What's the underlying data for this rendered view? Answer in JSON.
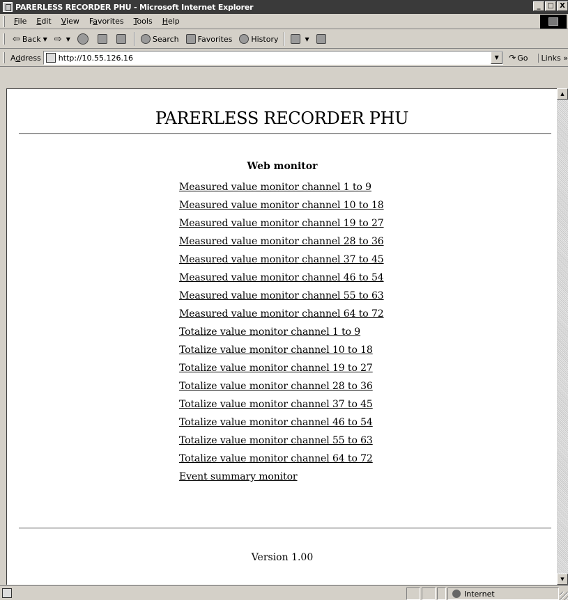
{
  "window": {
    "title": "PARERLESS RECORDER PHU - Microsoft Internet Explorer",
    "min": "_",
    "max": "□",
    "close": "X"
  },
  "menu": {
    "items": [
      {
        "key": "F",
        "rest": "ile"
      },
      {
        "key": "E",
        "rest": "dit"
      },
      {
        "key": "V",
        "rest": "iew"
      },
      {
        "pre": "F",
        "key": "a",
        "rest": "vorites"
      },
      {
        "key": "T",
        "rest": "ools"
      },
      {
        "key": "H",
        "rest": "elp"
      }
    ]
  },
  "toolbar": {
    "back": "Back",
    "search": "Search",
    "favorites": "Favorites",
    "history": "History"
  },
  "address": {
    "label_pre": "A",
    "label_key": "d",
    "label_rest": "dress",
    "url": "http://10.55.126.16",
    "go": "Go",
    "links": "Links »"
  },
  "page": {
    "title": "PARERLESS RECORDER PHU",
    "section": "Web monitor",
    "links": [
      "Measured value monitor channel 1 to 9",
      "Measured value monitor channel 10 to 18",
      "Measured value monitor channel 19 to 27",
      "Measured value monitor channel 28 to 36",
      "Measured value monitor channel 37 to 45",
      "Measured value monitor channel 46 to 54",
      "Measured value monitor channel 55 to 63",
      "Measured value monitor channel 64 to 72",
      "Totalize value monitor channel 1 to 9",
      "Totalize value monitor channel 10 to 18",
      "Totalize value monitor channel 19 to 27",
      "Totalize value monitor channel 28 to 36",
      "Totalize value monitor channel 37 to 45",
      "Totalize value monitor channel 46 to 54",
      "Totalize value monitor channel 55 to 63",
      "Totalize value monitor channel 64 to 72",
      "Event summary monitor"
    ],
    "version": "Version 1.00"
  },
  "status": {
    "zone": "Internet"
  }
}
